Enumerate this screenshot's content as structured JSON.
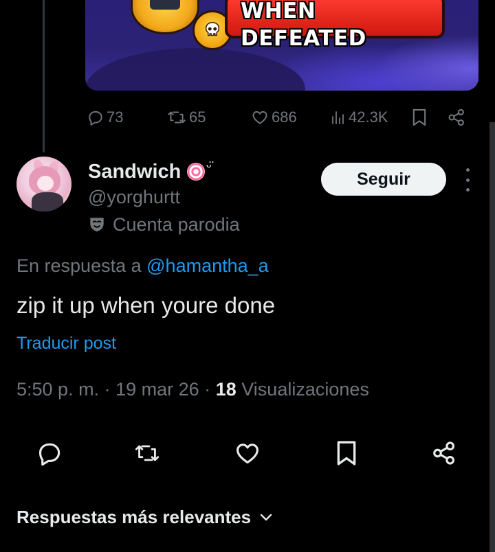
{
  "parent_post": {
    "banner_text": "WHEN DEFEATED",
    "stats": {
      "replies": "73",
      "reposts": "65",
      "likes": "686",
      "views": "42.3K"
    }
  },
  "post": {
    "author": {
      "display_name": "Sandwich",
      "name_decoration": "ᵕ̈",
      "handle": "@yorghurtt",
      "parody_label": "Cuenta parodia"
    },
    "follow_label": "Seguir",
    "reply_prefix": "En respuesta a",
    "reply_handle": "@hamantha_a",
    "text": "zip it up when youre done",
    "translate_label": "Traducir post",
    "time": "5:50 p. m.",
    "separator": "·",
    "date": "19 mar 26",
    "views_count": "18",
    "views_label": "Visualizaciones"
  },
  "replies_sort": {
    "label": "Respuestas más relevantes"
  },
  "colors": {
    "background": "#000000",
    "text": "#e7e9ea",
    "muted": "#71767b",
    "link": "#1d9bf0",
    "banner_red": "#e5281c"
  },
  "icons": [
    "reply-icon",
    "repost-icon",
    "like-icon",
    "views-icon",
    "bookmark-icon",
    "share-icon",
    "parody-mask-icon",
    "more-icon",
    "chevron-down-icon",
    "skull-icon"
  ]
}
